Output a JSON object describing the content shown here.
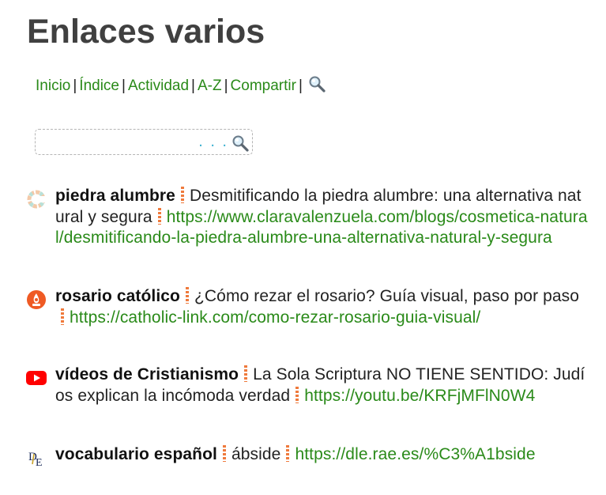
{
  "page": {
    "title": "Enlaces varios"
  },
  "nav": {
    "items": [
      {
        "label": "Inicio"
      },
      {
        "label": "Índice"
      },
      {
        "label": "Actividad"
      },
      {
        "label": "A-Z"
      },
      {
        "label": "Compartir"
      }
    ],
    "separator": "|"
  },
  "search": {
    "value": "",
    "dots": ". . ."
  },
  "entries": [
    {
      "term": "piedra alumbre",
      "description": "Desmitificando la piedra alumbre: una alternativa natural y segura",
      "url": "https://www.claravalenzuela.com/blogs/cosmetica-natural/desmitificando-la-piedra-alumbre-una-alternativa-natural-y-segura",
      "icon": "clara-valenzuela-c-icon"
    },
    {
      "term": "rosario católico",
      "description": "¿Cómo rezar el rosario? Guía visual, paso por paso",
      "url": "https://catholic-link.com/como-rezar-rosario-guia-visual/",
      "icon": "catholic-link-icon"
    },
    {
      "term": "vídeos de Cristianismo",
      "description": "La Sola Scriptura NO TIENE SENTIDO: Judíos explican la incómoda verdad",
      "url": "https://youtu.be/KRFjMFlN0W4",
      "icon": "youtube-icon"
    },
    {
      "term": "vocabulario español",
      "description": "ábside",
      "url": "https://dle.rae.es/%C3%A1bside",
      "icon": "dle-rae-icon"
    }
  ],
  "colors": {
    "link": "#2a8a19",
    "title": "#404040",
    "separator_bar": "#ef7a3c",
    "search_dots": "#3bb0d0",
    "youtube_red": "#ff0000",
    "catholic_orange": "#ef5a24"
  }
}
